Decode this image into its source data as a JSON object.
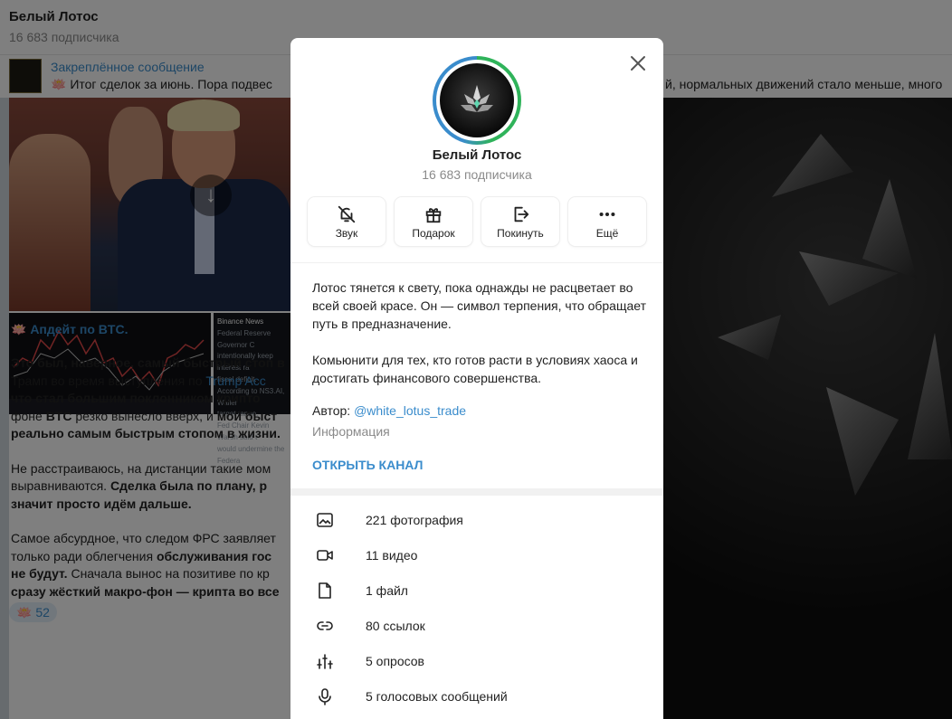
{
  "chat": {
    "title": "Белый Лотос",
    "subscribers": "16 683 подписчика"
  },
  "pinned": {
    "title": "Закреплённое сообщение",
    "text_left": "🪷 Итог сделок за июнь.  Пора подвес",
    "text_right": "й, нормальных движений стало меньше, много"
  },
  "message": {
    "news_source": "Binance News",
    "news_lines": [
      "Federal Reserve Governor C",
      "intentionally keep interest ra",
      "fiscal deficit.",
      "According to NS3.AI, Waller ",
      "target range.",
      "Fed Chair Kevin Warsh said t",
      "would undermine the Federa"
    ],
    "title": "🪷 Апдейт по BTC.",
    "p1_a": "Это был, наверное, самый быстрый стоп в",
    "p1_b_pre": "Трамп во время выступления по ",
    "p1_b_link": "Trump Acc",
    "p1_c": "что стал большим поклонником крипто",
    "p1_d_pre": "фоне ",
    "p1_d_bold": "BTC",
    "p1_d_mid": " резко вынесло вверх, и ",
    "p1_d_bold2": "мой быст",
    "p1_e": "реально самым быстрым стопом в жизни.",
    "p2_a": "Не расстраиваюсь, на дистанции такие мом",
    "p2_b_pre": "выравниваются. ",
    "p2_b_bold": "Сделка была по плану, р",
    "p2_c": "значит просто идём дальше.",
    "p3_a": "Самое абсурдное, что следом ФРС заявляет",
    "p3_b_pre": "только ради облегчения ",
    "p3_b_bold": "обслуживания гос",
    "p3_c_bold": "не будут.",
    "p3_c_rest": " Сначала вынос на позитиве по кр",
    "p3_d": "сразу жёсткий макро-фон — крипта во все",
    "reaction": "🪷 52"
  },
  "modal": {
    "title": "Белый Лотос",
    "subscribers": "16 683 подписчика",
    "actions": [
      {
        "label": "Звук",
        "icon": "bell-off-icon"
      },
      {
        "label": "Подарок",
        "icon": "gift-icon"
      },
      {
        "label": "Покинуть",
        "icon": "leave-icon"
      },
      {
        "label": "Ещё",
        "icon": "more-icon"
      }
    ],
    "desc_1": "Лотос тянется к свету, пока однажды не расцветает во всей своей красе. Он — символ терпения, что обращает путь в предназначение.",
    "desc_2": "Комьюнити для тех, кто готов расти в условиях хаоса и достигать финансового совершенства.",
    "author_prefix": "Автор: ",
    "author_handle": "@white_lotus_trade",
    "info_label": "Информация",
    "open_channel": "ОТКРЫТЬ КАНАЛ",
    "stats": [
      {
        "label": "221 фотография",
        "icon": "photo-icon"
      },
      {
        "label": "11 видео",
        "icon": "video-icon"
      },
      {
        "label": "1 файл",
        "icon": "file-icon"
      },
      {
        "label": "80 ссылок",
        "icon": "link-icon"
      },
      {
        "label": "5 опросов",
        "icon": "poll-icon"
      },
      {
        "label": "5 голосовых сообщений",
        "icon": "mic-icon"
      }
    ]
  },
  "colors": {
    "accent": "#3a8ccc",
    "ring_green": "#2fb35a",
    "overlay": "rgba(0,0,0,0.5)"
  }
}
